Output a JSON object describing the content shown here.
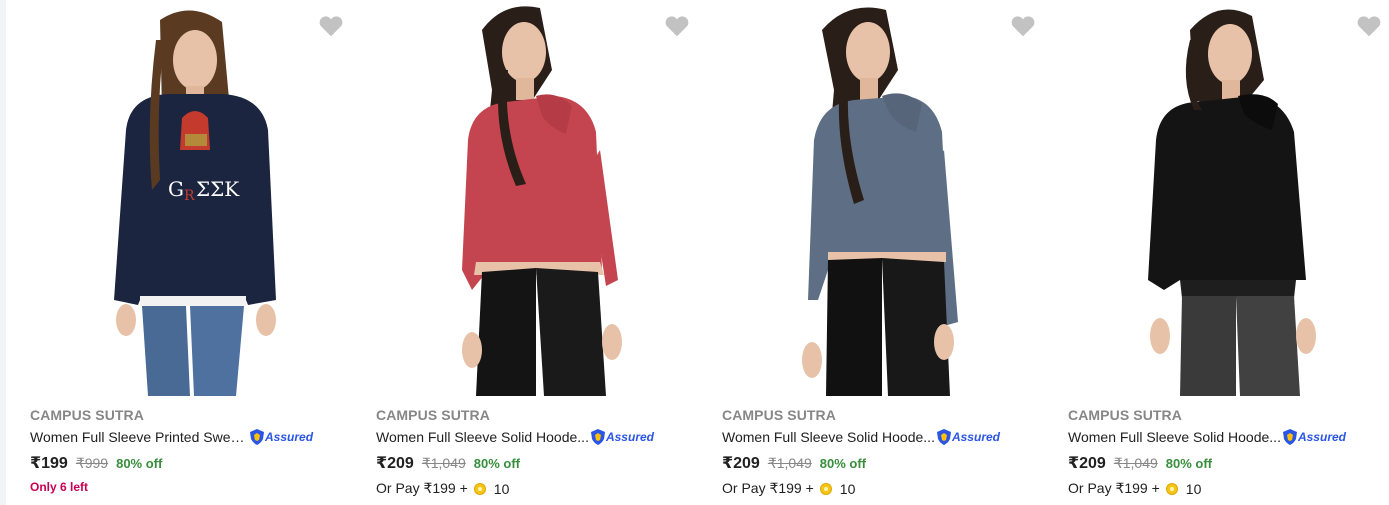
{
  "products": [
    {
      "brand": "CAMPUS SUTRA",
      "title": "Women Full Sleeve Printed Swea...",
      "assured_label": "Assured",
      "price": "₹199",
      "mrp": "₹999",
      "discount": "80% off",
      "stock_text": "Only 6 left",
      "wishlist_icon": "heart-icon",
      "image_colors": {
        "top": "#1c2540",
        "bottom": "#4a6a96",
        "hair": "#5b3a22"
      }
    },
    {
      "brand": "CAMPUS SUTRA",
      "title": "Women Full Sleeve Solid Hoode...",
      "assured_label": "Assured",
      "price": "₹209",
      "mrp": "₹1,049",
      "discount": "80% off",
      "pay_prefix": "Or Pay ₹199 +",
      "pay_coins": "10",
      "wishlist_icon": "heart-icon",
      "image_colors": {
        "top": "#c4454f",
        "bottom": "#141414",
        "hair": "#2a1e18"
      }
    },
    {
      "brand": "CAMPUS SUTRA",
      "title": "Women Full Sleeve Solid Hoode...",
      "assured_label": "Assured",
      "price": "₹209",
      "mrp": "₹1,049",
      "discount": "80% off",
      "pay_prefix": "Or Pay ₹199 +",
      "pay_coins": "10",
      "wishlist_icon": "heart-icon",
      "image_colors": {
        "top": "#5e6e84",
        "bottom": "#111111",
        "hair": "#2a1e18"
      }
    },
    {
      "brand": "CAMPUS SUTRA",
      "title": "Women Full Sleeve Solid Hoode...",
      "assured_label": "Assured",
      "price": "₹209",
      "mrp": "₹1,049",
      "discount": "80% off",
      "pay_prefix": "Or Pay ₹199 +",
      "pay_coins": "10",
      "wishlist_icon": "heart-icon",
      "image_colors": {
        "top": "#141414",
        "bottom": "#3a3a3a",
        "hair": "#2a1e18"
      }
    }
  ],
  "colors": {
    "brand_text": "#878787",
    "discount_green": "#388e3c",
    "assured_blue": "#2a55e5",
    "stock_pink": "#c70055",
    "wishlist_grey": "#c2c2c2"
  }
}
